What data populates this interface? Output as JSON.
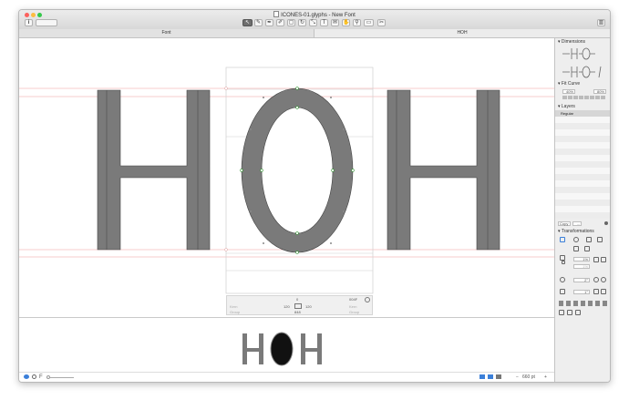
{
  "window": {
    "title": "ICONES-01.glyphs - New Font",
    "accent": "#3b7fd9"
  },
  "toolbar": {
    "info_label": "i",
    "tools": [
      "select-tool",
      "draw-tool",
      "pen-tool",
      "pencil-tool",
      "eraser-tool",
      "primitives-tool",
      "rotate-tool",
      "scale-tool",
      "text-tool",
      "annotation-tool",
      "hand-tool",
      "zoom-tool",
      "measure-tool",
      "knife-tool"
    ]
  },
  "tabs": [
    {
      "label": "Font"
    },
    {
      "label": "HOH"
    }
  ],
  "editor": {
    "text": [
      "H",
      "O",
      "H"
    ],
    "glyph_color": "#777777",
    "metric_line_color": "#e8a0a0",
    "info": {
      "lsb_value": "120",
      "rsb_value": "120",
      "width_value": "848",
      "unicode": "0",
      "code": "004F",
      "kern_label_left": "Kern",
      "kern_label_right": "Kern",
      "group_label_left": "Group",
      "group_label_right": "Group"
    }
  },
  "preview": {
    "text": "HOH"
  },
  "bottom_bar": {
    "font_size_label": "F",
    "size_value": "660 pt",
    "minus_label": "−",
    "plus_label": "+"
  },
  "panel": {
    "dimensions": {
      "title": "Dimensions"
    },
    "fit_curve": {
      "title": "Fit Curve",
      "min_value": "40%",
      "max_value": "80%"
    },
    "layers": {
      "title": "Layers",
      "items": [
        "Regular"
      ]
    },
    "copy": {
      "copy_label": "Copy",
      "paste_label": "..."
    },
    "transformations": {
      "title": "Transformations",
      "scale_value": "1%",
      "scale_value2": "1%",
      "rotate_value": "2°",
      "slant_value": "1°"
    }
  }
}
